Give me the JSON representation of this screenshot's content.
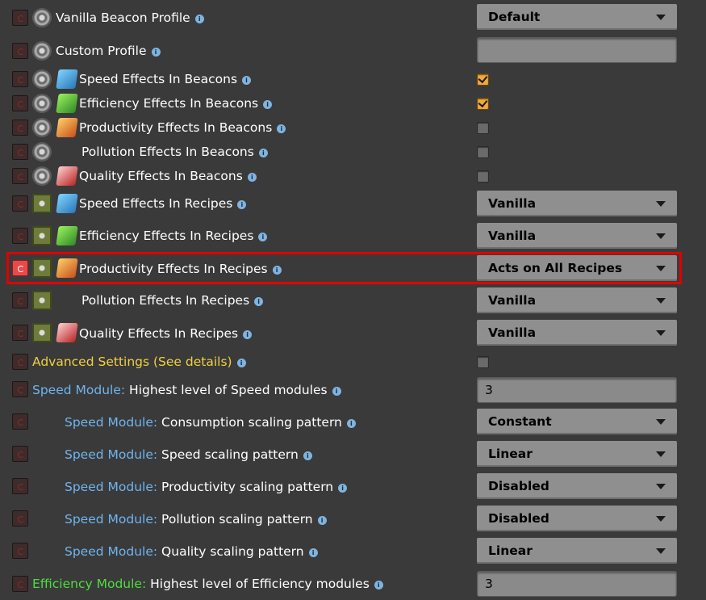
{
  "rows": [
    {
      "label": "Vanilla Beacon Profile",
      "control": {
        "type": "dropdown",
        "value": "Default"
      }
    },
    {
      "label": "Custom Profile",
      "control": {
        "type": "textbox",
        "value": ""
      }
    },
    {
      "label": "Speed Effects In Beacons",
      "control": {
        "type": "checkbox",
        "checked": true
      }
    },
    {
      "label": "Efficiency Effects In Beacons",
      "control": {
        "type": "checkbox",
        "checked": true
      }
    },
    {
      "label": "Productivity Effects In Beacons",
      "control": {
        "type": "checkbox",
        "checked": false
      }
    },
    {
      "label": "Pollution Effects In Beacons",
      "control": {
        "type": "checkbox",
        "checked": false
      }
    },
    {
      "label": "Quality Effects In Beacons",
      "control": {
        "type": "checkbox",
        "checked": false
      }
    },
    {
      "label": "Speed Effects In Recipes",
      "control": {
        "type": "dropdown",
        "value": "Vanilla"
      }
    },
    {
      "label": "Efficiency Effects In Recipes",
      "control": {
        "type": "dropdown",
        "value": "Vanilla"
      }
    },
    {
      "label": "Productivity Effects In Recipes",
      "control": {
        "type": "dropdown",
        "value": "Acts on All Recipes"
      }
    },
    {
      "label": "Pollution Effects In Recipes",
      "control": {
        "type": "dropdown",
        "value": "Vanilla"
      }
    },
    {
      "label": "Quality Effects In Recipes",
      "control": {
        "type": "dropdown",
        "value": "Vanilla"
      }
    },
    {
      "label": "Advanced Settings (See details)",
      "control": {
        "type": "checkbox",
        "checked": false
      }
    },
    {
      "prefix": "Speed Module:",
      "label": "Highest level of Speed modules",
      "control": {
        "type": "textbox",
        "value": "3"
      }
    },
    {
      "prefix": "Speed Module:",
      "label": "Consumption scaling pattern",
      "control": {
        "type": "dropdown",
        "value": "Constant"
      }
    },
    {
      "prefix": "Speed Module:",
      "label": "Speed scaling pattern",
      "control": {
        "type": "dropdown",
        "value": "Linear"
      }
    },
    {
      "prefix": "Speed Module:",
      "label": "Productivity scaling pattern",
      "control": {
        "type": "dropdown",
        "value": "Disabled"
      }
    },
    {
      "prefix": "Speed Module:",
      "label": "Pollution scaling pattern",
      "control": {
        "type": "dropdown",
        "value": "Disabled"
      }
    },
    {
      "prefix": "Speed Module:",
      "label": "Quality scaling pattern",
      "control": {
        "type": "dropdown",
        "value": "Linear"
      }
    },
    {
      "prefix": "Efficiency Module:",
      "label": "Highest level of Efficiency modules",
      "control": {
        "type": "textbox",
        "value": "3"
      }
    }
  ],
  "info_glyph": "i",
  "colors": {
    "background": "#3a3a3a",
    "highlight_border": "#e00000",
    "speed_prefix": "#6fb4f0",
    "efficiency_prefix": "#4fdc3f",
    "advanced_label": "#f2cf42",
    "checkbox_checked": "#f0a83a"
  }
}
